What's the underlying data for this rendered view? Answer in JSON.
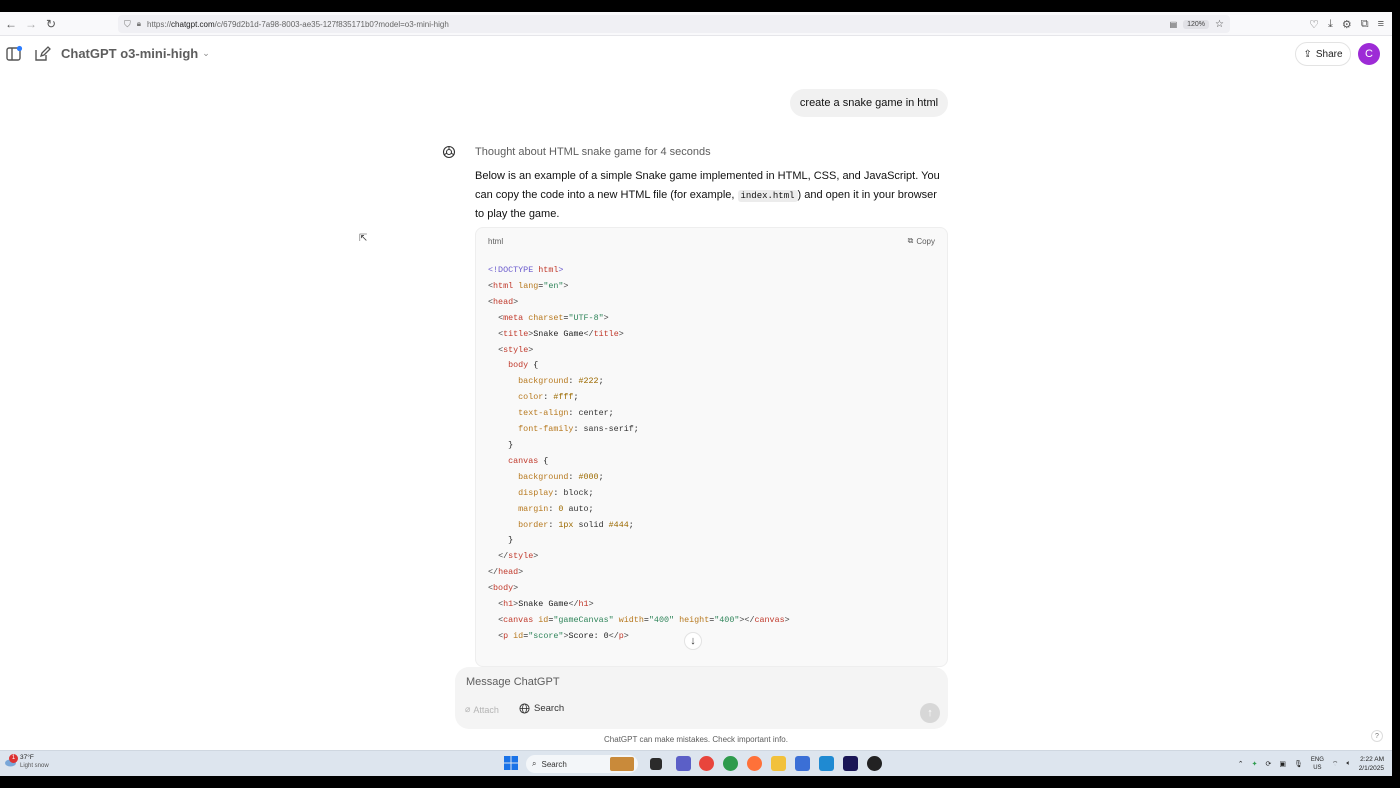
{
  "browser": {
    "url_prefix": "https://",
    "url_domain": "chatgpt.com",
    "url_path": "/c/679d2b1d-7a98-8003-ae35-127f835171b0?model=o3-mini-high",
    "zoom": "120%"
  },
  "header": {
    "model_title": "ChatGPT o3-mini-high",
    "share_label": "Share",
    "avatar_initial": "C"
  },
  "conversation": {
    "user_message": "create a snake game in html",
    "thought": "Thought about HTML snake game for 4 seconds",
    "intro_before": "Below is an example of a simple Snake game implemented in HTML, CSS, and JavaScript. You can copy the code into a new HTML file (for example, ",
    "intro_code": "index.html",
    "intro_after": ") and open it in your browser to play the game.",
    "code_lang": "html",
    "copy_label": "Copy"
  },
  "composer": {
    "placeholder": "Message ChatGPT",
    "attach_label": "Attach",
    "search_label": "Search"
  },
  "footer": {
    "disclaimer": "ChatGPT can make mistakes. Check important info.",
    "help": "?"
  },
  "taskbar": {
    "weather_badge": "1",
    "temperature": "37°F",
    "condition": "Light snow",
    "search_label": "Search",
    "lang_top": "ENG",
    "lang_bottom": "US",
    "time": "2:22 AM",
    "date": "2/1/2025"
  },
  "colors": {
    "avatar": "#9d2bd6",
    "taskbar": "#dde5ee"
  }
}
